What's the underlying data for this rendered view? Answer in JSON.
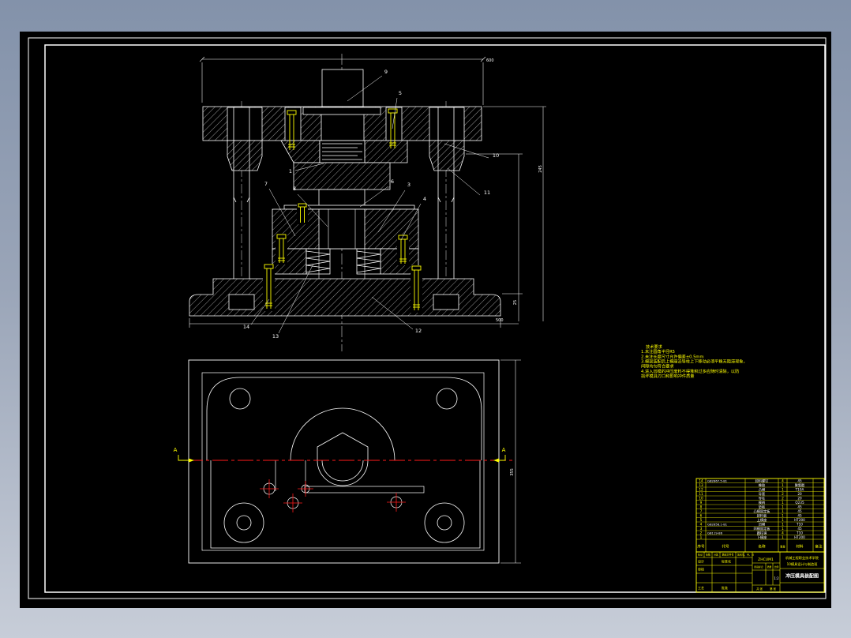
{
  "colors": {
    "canvas": "#000000",
    "line": "#ffffff",
    "accent": "#ffff00",
    "centerline_red": "#ff1a1a"
  },
  "drawing_title": "冲压模具装配图",
  "balloons": [
    "9",
    "5",
    "10",
    "11",
    "1",
    "7",
    "8",
    "6",
    "3",
    "4",
    "14",
    "13",
    "12"
  ],
  "dimensions": {
    "top": "600",
    "right_tall": "245",
    "right_small": "25",
    "bottom": "500",
    "plan_right": "355"
  },
  "section_marks": {
    "left": "A",
    "right": "A"
  },
  "notes": {
    "lines": [
      "技术要求",
      "1.未注圆角半径R5",
      "2.未注长度尺寸允许偏差±0.5mm",
      "3.模架装配后上模座沿导柱上下移动必须平稳无阻滞现象，",
      "  间隙均匀符合要求",
      "4.进入凹模的冲压废料不得堆积过多应随时清除，以防",
      "  损坏模具刃口和影响冲件质量"
    ]
  },
  "bom": {
    "headers": [
      "序号",
      "代号",
      "名称",
      "数量",
      "材料",
      "备注"
    ],
    "rows": [
      {
        "no": "14",
        "code": "GB2867.5-81",
        "name": "卸料螺钉",
        "qty": "4",
        "mat": "45"
      },
      {
        "no": "13",
        "code": "",
        "name": "橡胶",
        "qty": "1",
        "mat": "聚氨酯"
      },
      {
        "no": "12",
        "code": "",
        "name": "凸模",
        "qty": "1",
        "mat": "T10A"
      },
      {
        "no": "11",
        "code": "",
        "name": "导套",
        "qty": "2",
        "mat": "20"
      },
      {
        "no": "10",
        "code": "",
        "name": "导柱",
        "qty": "2",
        "mat": "20"
      },
      {
        "no": "9",
        "code": "",
        "name": "模柄",
        "qty": "1",
        "mat": "Q235"
      },
      {
        "no": "8",
        "code": "",
        "name": "垫板",
        "qty": "1",
        "mat": "45"
      },
      {
        "no": "7",
        "code": "",
        "name": "凸模固定板",
        "qty": "1",
        "mat": "45"
      },
      {
        "no": "6",
        "code": "",
        "name": "卸料板",
        "qty": "1",
        "mat": "45"
      },
      {
        "no": "5",
        "code": "",
        "name": "上模座",
        "qty": "1",
        "mat": "HT200"
      },
      {
        "no": "4",
        "code": "GB2858.1-81",
        "name": "凹模",
        "qty": "1",
        "mat": "T10"
      },
      {
        "no": "3",
        "code": "",
        "name": "凹模固定板",
        "qty": "1",
        "mat": "45"
      },
      {
        "no": "2",
        "code": "GB119-86",
        "name": "圆柱销",
        "qty": "4",
        "mat": "T10"
      },
      {
        "no": "1",
        "code": "",
        "name": "下模座",
        "qty": "1",
        "mat": "HT200"
      }
    ]
  },
  "title_block": {
    "edit_row": [
      "标记",
      "处数",
      "分区",
      "更改文件号",
      "签名",
      "年、月、日"
    ],
    "design": "设计",
    "check": "审核",
    "process": "工艺",
    "standard": "标准化",
    "approve": "批准",
    "stage": "阶段标记",
    "mass": "质量",
    "scale_label": "比例",
    "scale": "1:2",
    "sheet_total": "共 张",
    "sheet_no": "第 张",
    "code": "ZHCUM1",
    "org1": "机械工程职业技术学院",
    "org2": "10模具设计与制造班",
    "title": "冲压模具装配图"
  }
}
